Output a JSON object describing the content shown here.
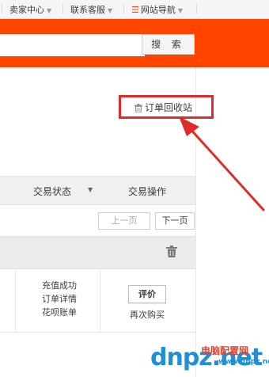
{
  "topbar": {
    "seller_center": "卖家中心",
    "customer_service": "联系客服",
    "site_nav": "网站导航"
  },
  "search": {
    "button_label": "搜 索",
    "placeholder": ""
  },
  "orders": {
    "recycle_bin_label": "订单回收站",
    "columns": {
      "status": "交易状态",
      "actions": "交易操作"
    },
    "pager": {
      "prev": "上一页",
      "next": "下一页"
    },
    "item": {
      "links": [
        "充值成功",
        "订单详情",
        "花呗账单"
      ],
      "rate_label": "评价",
      "rebuy_label": "再次购买"
    }
  },
  "watermark": {
    "brand": "dnpz.net",
    "brand_cn": "电脑配置网",
    "url": "www.dnpz.net"
  },
  "colors": {
    "brand_orange": "#ff4400",
    "highlight_red": "#e02b2b",
    "watermark_blue": "#1f8fd6"
  },
  "icons": [
    "caret-down-icon",
    "menu-icon",
    "trash-icon",
    "arrow-annotation"
  ]
}
